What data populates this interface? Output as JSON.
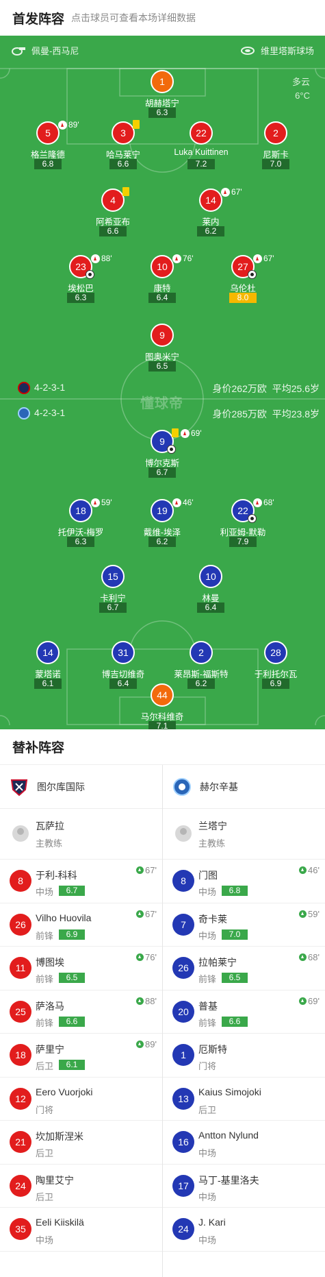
{
  "header": {
    "title": "首发阵容",
    "hint": "点击球员可查看本场详细数据"
  },
  "field": {
    "coach_left": "佩曼-西马尼",
    "stadium": "维里塔斯球场",
    "weather": {
      "desc": "多云",
      "temp": "6°C"
    },
    "watermark": "懂球帝",
    "home_row": {
      "formation": "4-2-3-1",
      "value": "身价262万欧",
      "age": "平均25.6岁"
    },
    "away_row": {
      "formation": "4-2-3-1",
      "value": "身价285万欧",
      "age": "平均23.8岁"
    }
  },
  "players": [
    {
      "num": "1",
      "name": "胡赫塔宁",
      "rating": "6.3",
      "color": "orange"
    },
    {
      "num": "5",
      "name": "格兰隆德",
      "rating": "6.8",
      "color": "red",
      "sub": "89'"
    },
    {
      "num": "3",
      "name": "哈马莱宁",
      "rating": "6.6",
      "color": "red",
      "yellow": true
    },
    {
      "num": "22",
      "name": "Luka Kuittinen",
      "rating": "7.2",
      "color": "red"
    },
    {
      "num": "2",
      "name": "尼斯卡",
      "rating": "7.0",
      "color": "red"
    },
    {
      "num": "4",
      "name": "阿希亚布",
      "rating": "6.6",
      "color": "red",
      "yellow": true
    },
    {
      "num": "14",
      "name": "莱内",
      "rating": "6.2",
      "color": "red",
      "sub": "67'"
    },
    {
      "num": "23",
      "name": "埃松巴",
      "rating": "6.3",
      "color": "red",
      "sub": "88'",
      "ball": true
    },
    {
      "num": "10",
      "name": "康特",
      "rating": "6.4",
      "color": "red",
      "sub": "76'"
    },
    {
      "num": "27",
      "name": "乌伦杜",
      "rating": "8.0",
      "color": "red",
      "sub": "67'",
      "ball": true,
      "gold": true
    },
    {
      "num": "9",
      "name": "图奥米宁",
      "rating": "6.5",
      "color": "red"
    },
    {
      "num": "9",
      "name": "博尔克斯",
      "rating": "6.7",
      "color": "blue",
      "sub": "69'",
      "yellow": true,
      "ball": true
    },
    {
      "num": "18",
      "name": "托伊沃-梅罗",
      "rating": "6.3",
      "color": "blue",
      "sub": "59'"
    },
    {
      "num": "19",
      "name": "戴维-埃泽",
      "rating": "6.2",
      "color": "blue",
      "sub": "46'"
    },
    {
      "num": "22",
      "name": "利亚姆-默勒",
      "rating": "7.9",
      "color": "blue",
      "sub": "68'",
      "ball": true
    },
    {
      "num": "15",
      "name": "卡利宁",
      "rating": "6.7",
      "color": "blue"
    },
    {
      "num": "10",
      "name": "林曼",
      "rating": "6.4",
      "color": "blue"
    },
    {
      "num": "14",
      "name": "蒙塔诺",
      "rating": "6.1",
      "color": "blue"
    },
    {
      "num": "31",
      "name": "博吉切维奇",
      "rating": "6.4",
      "color": "blue"
    },
    {
      "num": "2",
      "name": "莱昂斯-福斯特",
      "rating": "6.2",
      "color": "blue"
    },
    {
      "num": "28",
      "name": "于利托尔瓦",
      "rating": "6.9",
      "color": "blue"
    },
    {
      "num": "44",
      "name": "马尔科维奇",
      "rating": "7.1",
      "color": "orange"
    }
  ],
  "subs": {
    "title": "替补阵容",
    "home": {
      "team": "图尔库国际",
      "coach": {
        "name": "瓦萨拉",
        "role": "主教练"
      },
      "list": [
        {
          "num": "8",
          "name": "于利-科科",
          "pos": "中场",
          "rating": "6.7",
          "time": "67'"
        },
        {
          "num": "26",
          "name": "Vilho Huovila",
          "pos": "前锋",
          "rating": "6.9",
          "time": "67'"
        },
        {
          "num": "11",
          "name": "博图埃",
          "pos": "前锋",
          "rating": "6.5",
          "time": "76'"
        },
        {
          "num": "25",
          "name": "萨洛马",
          "pos": "前锋",
          "rating": "6.6",
          "time": "88'"
        },
        {
          "num": "18",
          "name": "萨里宁",
          "pos": "后卫",
          "rating": "6.1",
          "time": "89'"
        },
        {
          "num": "12",
          "name": "Eero Vuorjoki",
          "pos": "门将"
        },
        {
          "num": "21",
          "name": "坎加斯涅米",
          "pos": "后卫"
        },
        {
          "num": "24",
          "name": "陶里艾宁",
          "pos": "后卫"
        },
        {
          "num": "35",
          "name": "Eeli Kiiskilä",
          "pos": "中场"
        }
      ]
    },
    "away": {
      "team": "赫尔辛基",
      "coach": {
        "name": "兰塔宁",
        "role": "主教练"
      },
      "list": [
        {
          "num": "8",
          "name": "门图",
          "pos": "中场",
          "rating": "6.8",
          "time": "46'"
        },
        {
          "num": "7",
          "name": "奇卡莱",
          "pos": "中场",
          "rating": "7.0",
          "time": "59'"
        },
        {
          "num": "26",
          "name": "拉帕莱宁",
          "pos": "前锋",
          "rating": "6.5",
          "time": "68'"
        },
        {
          "num": "20",
          "name": "普基",
          "pos": "前锋",
          "rating": "6.6",
          "time": "69'"
        },
        {
          "num": "1",
          "name": "厄斯特",
          "pos": "门将"
        },
        {
          "num": "13",
          "name": "Kaius Simojoki",
          "pos": "后卫"
        },
        {
          "num": "16",
          "name": "Antton Nylund",
          "pos": "中场"
        },
        {
          "num": "17",
          "name": "马丁-基里洛夫",
          "pos": "中场"
        },
        {
          "num": "24",
          "name": "J. Kari",
          "pos": "中场"
        }
      ]
    }
  }
}
